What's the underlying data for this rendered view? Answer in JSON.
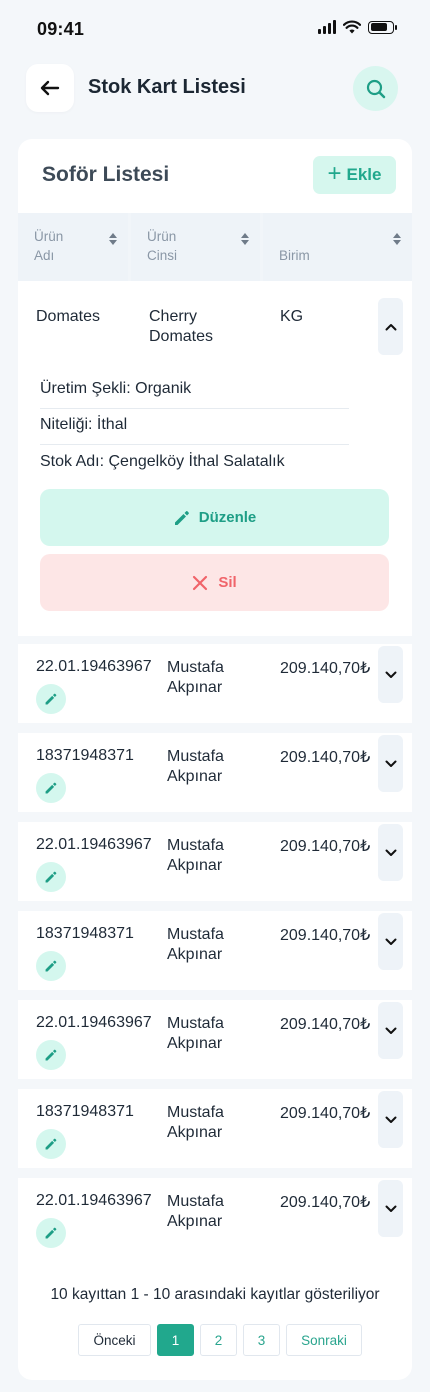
{
  "status_bar": {
    "time": "09:41"
  },
  "header": {
    "title": "Stok Kart Listesi"
  },
  "card": {
    "title": "Soför Listesi",
    "add_label": "Ekle",
    "columns": [
      {
        "line1": "Ürün",
        "line2": "Adı"
      },
      {
        "line1": "Ürün",
        "line2": "Cinsi"
      },
      {
        "line1": "",
        "line2": "Birim"
      }
    ],
    "expanded_row": {
      "name": "Domates",
      "type_line1": "Cherry",
      "type_line2": "Domates",
      "unit": "KG",
      "details": [
        "Üretim Şekli: Organik",
        "Niteliği: İthal",
        "Stok Adı: Çengelköy İthal Salatalık"
      ],
      "edit_label": "Düzenle",
      "delete_label": "Sil"
    },
    "rows": [
      {
        "id": "22.01.19463967",
        "name_line1": "Mustafa",
        "name_line2": "Akpınar",
        "amount": "209.140,70₺"
      },
      {
        "id": "18371948371",
        "name_line1": "Mustafa",
        "name_line2": "Akpınar",
        "amount": "209.140,70₺"
      },
      {
        "id": "22.01.19463967",
        "name_line1": "Mustafa",
        "name_line2": "Akpınar",
        "amount": "209.140,70₺"
      },
      {
        "id": "18371948371",
        "name_line1": "Mustafa",
        "name_line2": "Akpınar",
        "amount": "209.140,70₺"
      },
      {
        "id": "22.01.19463967",
        "name_line1": "Mustafa",
        "name_line2": "Akpınar",
        "amount": "209.140,70₺"
      },
      {
        "id": "18371948371",
        "name_line1": "Mustafa",
        "name_line2": "Akpınar",
        "amount": "209.140,70₺"
      },
      {
        "id": "22.01.19463967",
        "name_line1": "Mustafa",
        "name_line2": "Akpınar",
        "amount": "209.140,70₺"
      }
    ]
  },
  "footer": {
    "info": "10 kayıttan 1 - 10 arasındaki kayıtlar gösteriliyor",
    "prev_label": "Önceki",
    "pages": [
      "1",
      "2",
      "3"
    ],
    "next_label": "Sonraki"
  },
  "colors": {
    "accent": "#21a88d",
    "accent_light": "#d4f7ee",
    "danger": "#f0646a",
    "danger_light": "#fde6e6",
    "background": "#f4f7fa"
  }
}
